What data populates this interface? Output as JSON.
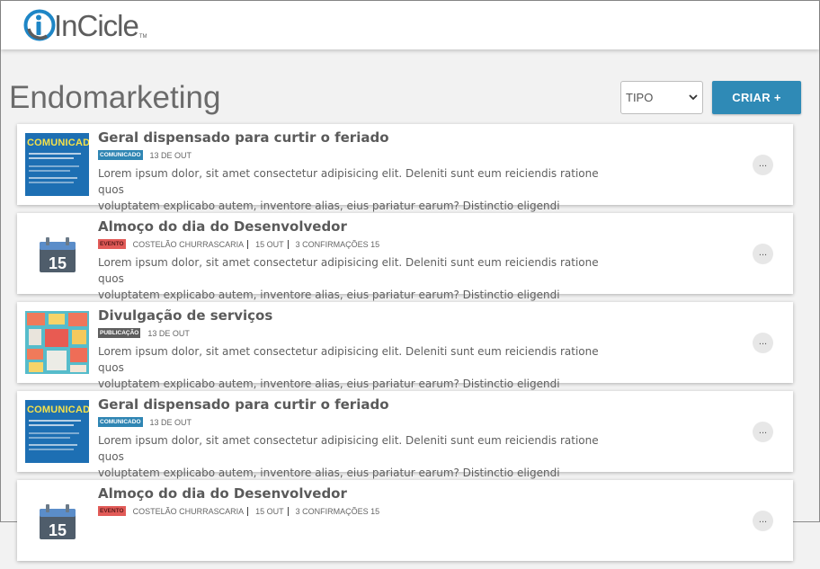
{
  "app": {
    "logo_text": "InCicle",
    "logo_tm": "TM"
  },
  "page": {
    "title": "Endomarketing",
    "filter": {
      "selected": "TIPO",
      "arrow_icon": "chevron-down-icon"
    },
    "create_label": "CRIAR +"
  },
  "colors": {
    "accent": "#2f8ab6",
    "comunicado_badge": "#2f85b3",
    "evento_badge": "#e25b58",
    "publicacao_badge": "#5e5e5e"
  },
  "posts": [
    {
      "title": "Geral dispensado para curtir o feriado",
      "type": "COMUNICADO",
      "thumb_text": "COMUNICADO",
      "date": "13 DE OUT",
      "description_line1": "Lorem ipsum dolor, sit amet consectetur adipisicing elit. Deleniti sunt eum reiciendis ratione quos",
      "description_line2": "voluptatem explicabo autem, inventore alias, eius pariatur earum? Distinctio eligendi accusamus",
      "more": "..."
    },
    {
      "title": "Almoço do dia do Desenvolvedor",
      "type": "EVENTO",
      "thumb_text": "15",
      "location": "COSTELÃO CHURRASCARIA",
      "date": "15 OUT",
      "confirmations": "3 CONFIRMAÇÕES 15",
      "description_line1": "Lorem ipsum dolor, sit amet consectetur adipisicing elit. Deleniti sunt eum reiciendis ratione quos",
      "description_line2": "voluptatem explicabo autem, inventore alias, eius pariatur earum? Distinctio eligendi accusamus",
      "more": "..."
    },
    {
      "title": "Divulgação de serviços",
      "type": "PUBLICAÇÃO",
      "date": "13 DE OUT",
      "description_line1": "Lorem ipsum dolor, sit amet consectetur adipisicing elit. Deleniti sunt eum reiciendis ratione quos",
      "description_line2": "voluptatem explicabo autem, inventore alias, eius pariatur earum? Distinctio eligendi accusamus",
      "more": "..."
    },
    {
      "title": "Geral dispensado para curtir o feriado",
      "type": "COMUNICADO",
      "thumb_text": "COMUNICADO",
      "date": "13 DE OUT",
      "description_line1": "Lorem ipsum dolor, sit amet consectetur adipisicing elit. Deleniti sunt eum reiciendis ratione quos",
      "description_line2": "voluptatem explicabo autem, inventore alias, eius pariatur earum? Distinctio eligendi accusamus",
      "more": "..."
    },
    {
      "title": "Almoço do dia do Desenvolvedor",
      "type": "EVENTO",
      "thumb_text": "15",
      "location": "COSTELÃO CHURRASCARIA",
      "date": "15 OUT",
      "confirmations": "3 CONFIRMAÇÕES 15",
      "more": "..."
    }
  ]
}
